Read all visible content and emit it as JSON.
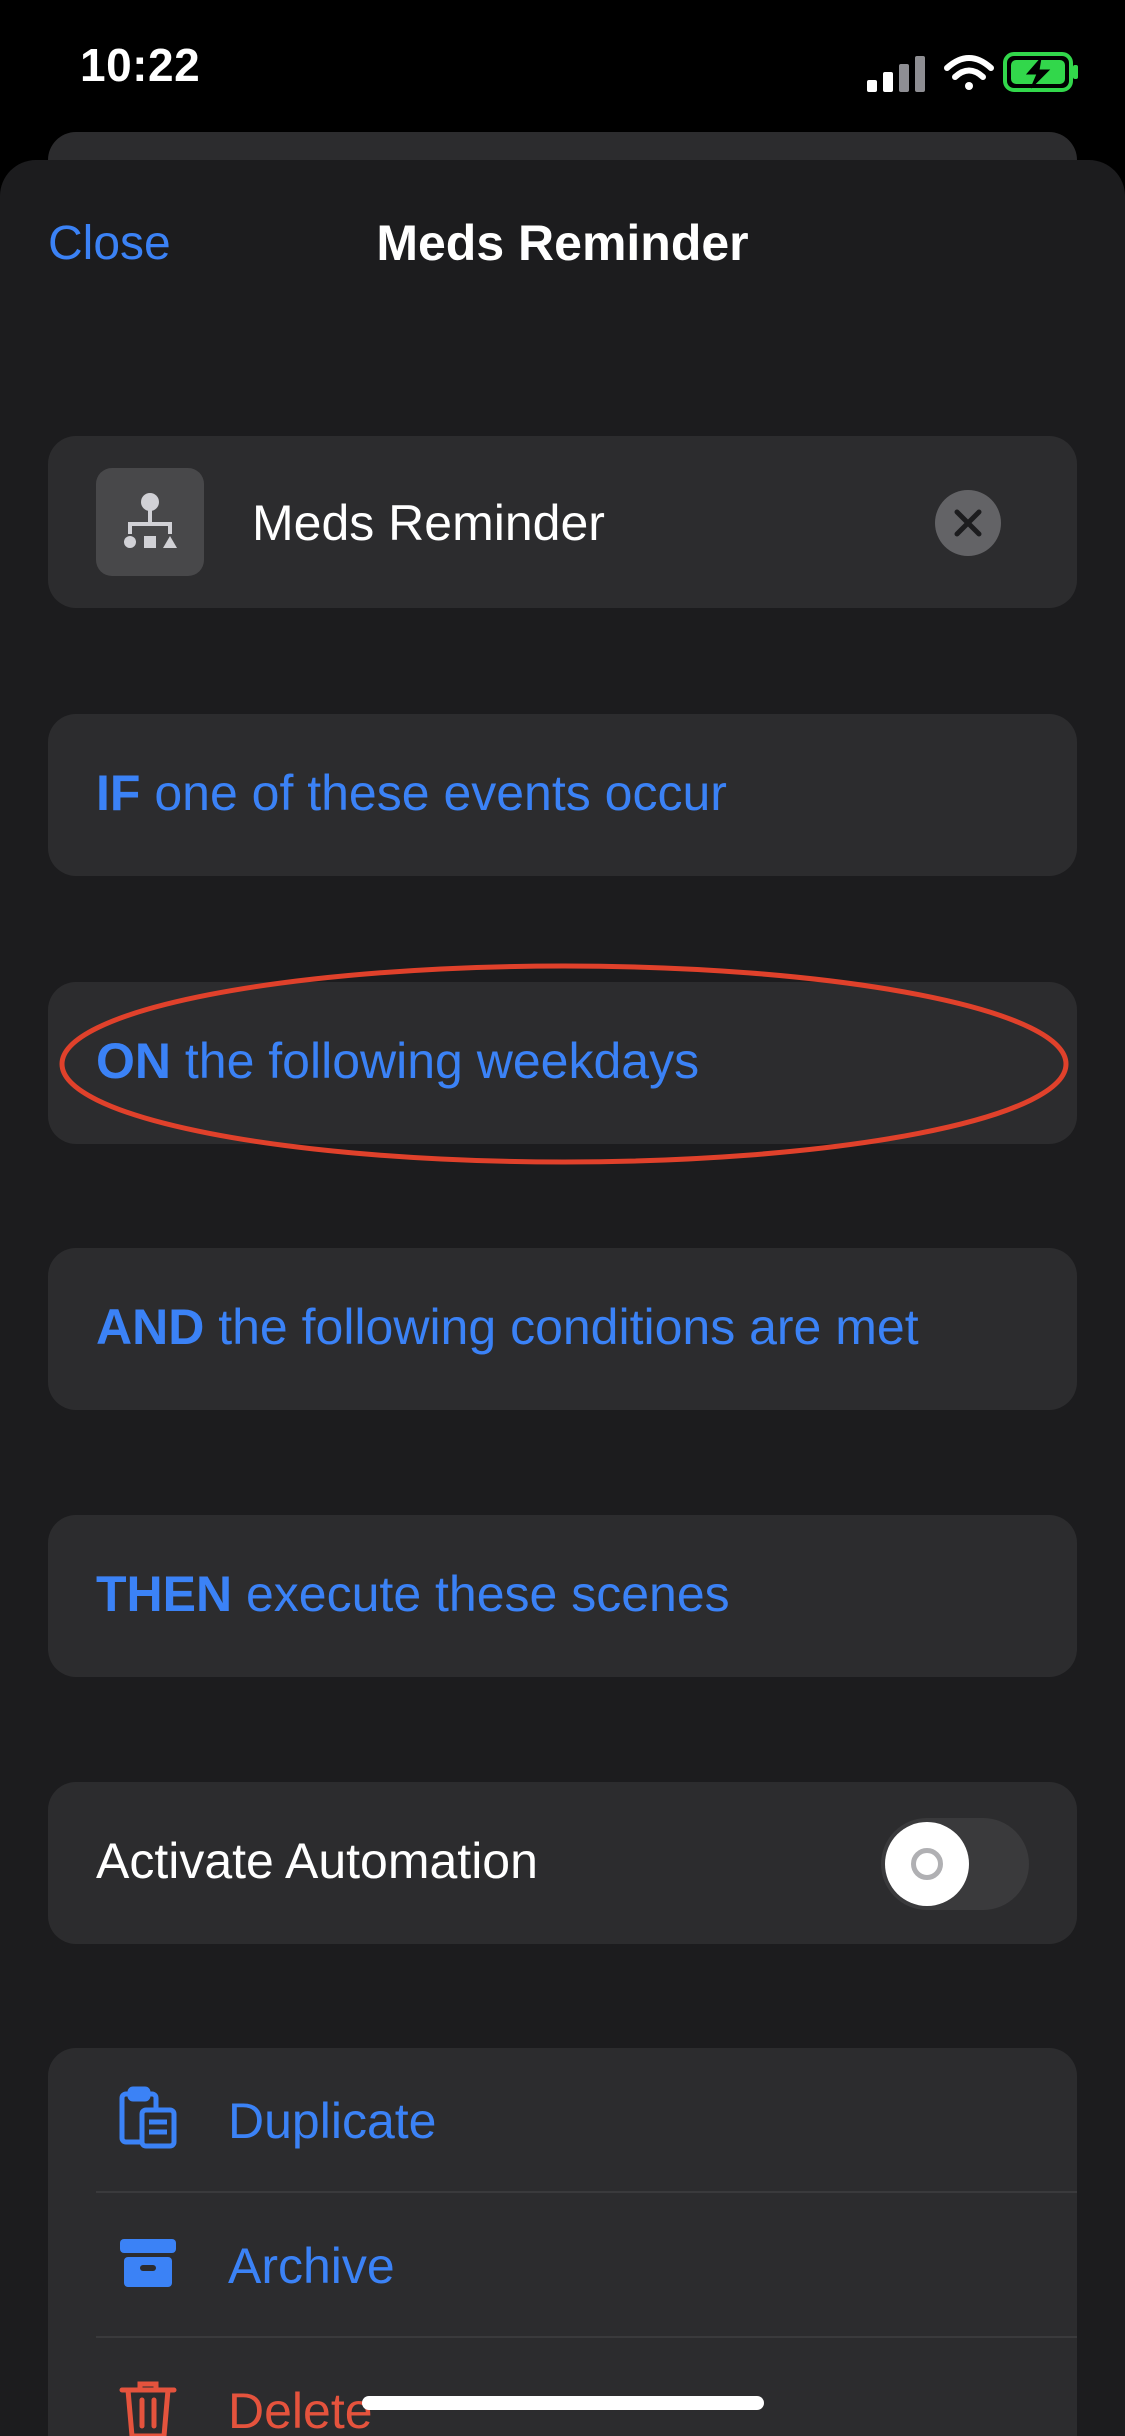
{
  "status_bar": {
    "time": "10:22",
    "icons": [
      "cellular-signal-icon",
      "wifi-icon",
      "battery-charging-icon"
    ],
    "battery_color": "#32d74b"
  },
  "nav": {
    "close_label": "Close",
    "title": "Meds Reminder"
  },
  "name_card": {
    "icon": "automation-flow-icon",
    "value": "Meds Reminder",
    "clear_icon": "clear-icon"
  },
  "sections": {
    "if": {
      "keyword": "IF",
      "text": " one of these events occur"
    },
    "on": {
      "keyword": "ON",
      "text": " the following weekdays"
    },
    "and": {
      "keyword": "AND",
      "text": " the following conditions are met"
    },
    "then": {
      "keyword": "THEN",
      "text": " execute these scenes"
    }
  },
  "activate": {
    "label": "Activate Automation",
    "enabled": false
  },
  "actions": [
    {
      "label": "Duplicate",
      "icon": "duplicate-icon"
    },
    {
      "label": "Archive",
      "icon": "archive-icon"
    },
    {
      "label": "Delete",
      "icon": "trash-icon"
    }
  ],
  "colors": {
    "accent": "#3b82f6",
    "destructive": "#e5533d",
    "annotation": "#e0412b",
    "sheet": "#1c1c1e",
    "card": "#2c2c2e"
  }
}
